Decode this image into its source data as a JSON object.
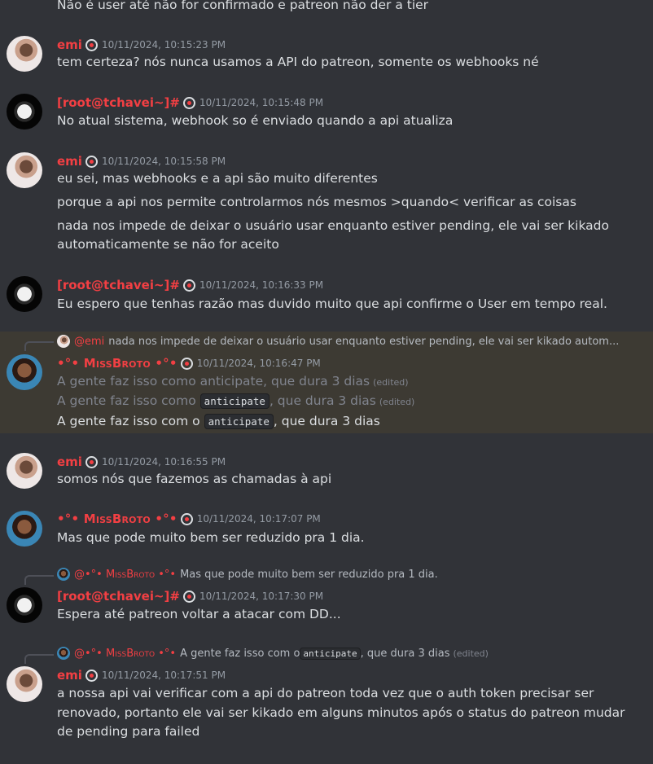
{
  "messages": [
    {
      "id": "m0",
      "cont": "Não é user até não for confirmado e patreon não der a tier"
    },
    {
      "id": "m1",
      "author": "emi",
      "timestamp": "10/11/2024, 10:15:23 PM",
      "lines": [
        "tem certeza? nós nunca usamos a API do patreon, somente os webhooks né"
      ]
    },
    {
      "id": "m2",
      "author": "[root@tchavei~]#",
      "timestamp": "10/11/2024, 10:15:48 PM",
      "lines": [
        "No atual sistema, webhook so é enviado quando a api atualiza"
      ]
    },
    {
      "id": "m3",
      "author": "emi",
      "timestamp": "10/11/2024, 10:15:58 PM",
      "lines": [
        "eu sei, mas webhooks e a api são muito diferentes",
        "porque a api nos permite controlarmos nós mesmos >quando< verificar as coisas",
        "nada nos impede de deixar o usuário usar enquanto estiver pending, ele vai ser kikado",
        "automaticamente se não for aceito"
      ]
    },
    {
      "id": "m4",
      "author": "[root@tchavei~]#",
      "timestamp": "10/11/2024, 10:16:33 PM",
      "lines": [
        "Eu espero que tenhas razão mas duvido muito que api confirme o User em tempo real."
      ]
    },
    {
      "id": "m5",
      "reply": {
        "mention": "@emi",
        "text": "nada nos impede de deixar o usuário usar enquanto estiver pending, ele vai ser kikado autom..."
      },
      "author": "•°• MissBroto •°•",
      "timestamp": "10/11/2024, 10:16:47 PM",
      "line1": "A gente faz isso como anticipate, que dura 3 dias",
      "line2_a": "A gente faz isso como ",
      "line2_code": "anticipate",
      "line2_b": ", que dura 3 dias",
      "line3_a": "A gente faz isso com o ",
      "line3_code": "anticipate",
      "line3_b": ", que dura 3 dias",
      "edited": "(edited)"
    },
    {
      "id": "m6",
      "author": "emi",
      "timestamp": "10/11/2024, 10:16:55 PM",
      "lines": [
        "somos nós que fazemos as chamadas à api"
      ]
    },
    {
      "id": "m7",
      "author": "•°• MissBroto •°•",
      "timestamp": "10/11/2024, 10:17:07 PM",
      "lines": [
        "Mas que pode muito bem ser reduzido pra 1 dia."
      ]
    },
    {
      "id": "m8",
      "reply": {
        "mention": "@•°• MissBroto •°•",
        "text": "Mas que pode muito bem ser reduzido pra 1 dia."
      },
      "author": "[root@tchavei~]#",
      "timestamp": "10/11/2024, 10:17:30 PM",
      "lines": [
        "Espera até patreon voltar a atacar com DD..."
      ]
    },
    {
      "id": "m9",
      "reply": {
        "mention": "@•°• MissBroto •°•",
        "text_a": "A gente faz isso com o ",
        "code": "anticipate",
        "text_b": ", que dura 3 dias",
        "edited": "(edited)"
      },
      "author": "emi",
      "timestamp": "10/11/2024, 10:17:51 PM",
      "lines": [
        "a nossa api vai verificar com a api do patreon toda vez que o auth token precisar ser",
        "renovado, portanto ele vai ser kikado em alguns minutos após o status do patreon mudar",
        "de pending para failed"
      ]
    }
  ]
}
